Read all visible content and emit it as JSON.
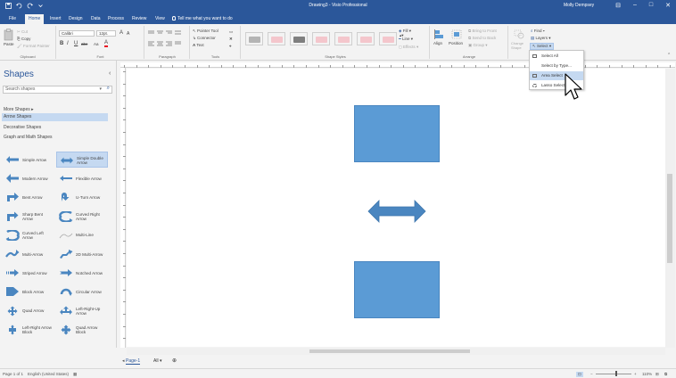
{
  "window": {
    "title": "Drawing3 - Visio Professional",
    "user": "Molly Dempsey",
    "controls": [
      "⊟",
      "–",
      "□",
      "✕"
    ]
  },
  "tabs": [
    {
      "label": "File",
      "active": false
    },
    {
      "label": "Home",
      "active": true
    },
    {
      "label": "Insert",
      "active": false
    },
    {
      "label": "Design",
      "active": false
    },
    {
      "label": "Data",
      "active": false
    },
    {
      "label": "Process",
      "active": false
    },
    {
      "label": "Review",
      "active": false
    },
    {
      "label": "View",
      "active": false
    }
  ],
  "tell_me": "Tell me what you want to do",
  "ribbon": {
    "clipboard": {
      "paste": "Paste",
      "cut": "Cut",
      "copy": "Copy",
      "format_painter": "Format Painter",
      "label": "Clipboard"
    },
    "font": {
      "family": "Calibri",
      "size": "12pt.",
      "grow": "A",
      "shrink": "A",
      "bold": "B",
      "italic": "I",
      "underline": "U",
      "strike": "abc",
      "case": "Aa",
      "color": "A",
      "label": "Font"
    },
    "paragraph": {
      "label": "Paragraph"
    },
    "tools": {
      "pointer": "Pointer Tool",
      "connector": "Connector",
      "text": "Text",
      "label": "Tools"
    },
    "shape_styles": {
      "fill": "Fill",
      "line": "Line",
      "effects": "Effects",
      "label": "Shape Styles"
    },
    "arrange": {
      "align": "Align",
      "position": "Position",
      "bring_front": "Bring to Front",
      "send_back": "Send to Back",
      "group": "Group",
      "label": "Arrange"
    },
    "editing": {
      "change_shape": "Change Shape",
      "find": "Find",
      "layers": "Layers",
      "select": "Select"
    }
  },
  "style_colors": [
    "#b4b4b4",
    "#f4c6cc",
    "#7f7f7f",
    "#f4c6cc",
    "#f4c6cc",
    "#f4c6cc",
    "#f4c6cc"
  ],
  "shapes_panel": {
    "title": "Shapes",
    "search_placeholder": "Search shapes",
    "more_shapes": "More Shapes",
    "stencils": [
      "Arrow Shapes",
      "Decorative Shapes",
      "Graph and Math Shapes"
    ],
    "active_stencil": "Arrow Shapes",
    "items": [
      {
        "label": "Simple Arrow",
        "icon": "simple-arrow-icon",
        "selected": false
      },
      {
        "label": "Simple Double Arrow",
        "icon": "double-arrow-icon",
        "selected": true
      },
      {
        "label": "Modern Arrow",
        "icon": "modern-arrow-icon",
        "selected": false
      },
      {
        "label": "Flexible Arrow",
        "icon": "flexible-arrow-icon",
        "selected": false
      },
      {
        "label": "Bent Arrow",
        "icon": "bent-arrow-icon",
        "selected": false
      },
      {
        "label": "U-Turn Arrow",
        "icon": "u-turn-arrow-icon",
        "selected": false
      },
      {
        "label": "Sharp Bent Arrow",
        "icon": "sharp-bent-arrow-icon",
        "selected": false
      },
      {
        "label": "Curved Right Arrow",
        "icon": "curved-right-arrow-icon",
        "selected": false
      },
      {
        "label": "Curved Left Arrow",
        "icon": "curved-left-arrow-icon",
        "selected": false
      },
      {
        "label": "Multi-Line",
        "icon": "multi-line-icon",
        "selected": false
      },
      {
        "label": "Multi-Arrow",
        "icon": "multi-arrow-icon",
        "selected": false
      },
      {
        "label": "2D Multi-Arrow",
        "icon": "2d-multi-arrow-icon",
        "selected": false
      },
      {
        "label": "Striped Arrow",
        "icon": "striped-arrow-icon",
        "selected": false
      },
      {
        "label": "Notched Arrow",
        "icon": "notched-arrow-icon",
        "selected": false
      },
      {
        "label": "Block Arrow",
        "icon": "block-arrow-icon",
        "selected": false
      },
      {
        "label": "Circular Arrow",
        "icon": "circular-arrow-icon",
        "selected": false
      },
      {
        "label": "Quad Arrow",
        "icon": "quad-arrow-icon",
        "selected": false
      },
      {
        "label": "Left-Right-Up Arrow",
        "icon": "left-right-up-arrow-icon",
        "selected": false
      },
      {
        "label": "Left-Right Arrow Block",
        "icon": "left-right-arrow-block-icon",
        "selected": false
      },
      {
        "label": "Quad Arrow Block",
        "icon": "quad-arrow-block-icon",
        "selected": false
      }
    ]
  },
  "select_menu": {
    "items": [
      {
        "label": "Select All",
        "icon": "select-all-icon",
        "hover": false
      },
      {
        "label": "Select by Type...",
        "icon": "",
        "hover": false
      },
      {
        "label": "Area Select",
        "icon": "area-select-icon",
        "hover": true
      },
      {
        "label": "Lasso Select",
        "icon": "lasso-select-icon",
        "hover": false
      }
    ]
  },
  "page_tabs": {
    "current": "Page-1",
    "all": "All",
    "add": "⊕"
  },
  "status": {
    "page": "Page 1 of 1",
    "language": "English (United States)",
    "zoom": "110%"
  },
  "colors": {
    "accent": "#2b579a",
    "shape_fill": "#5b9bd5",
    "shape_border": "#4a86c0",
    "selection": "#c5d9f1"
  }
}
